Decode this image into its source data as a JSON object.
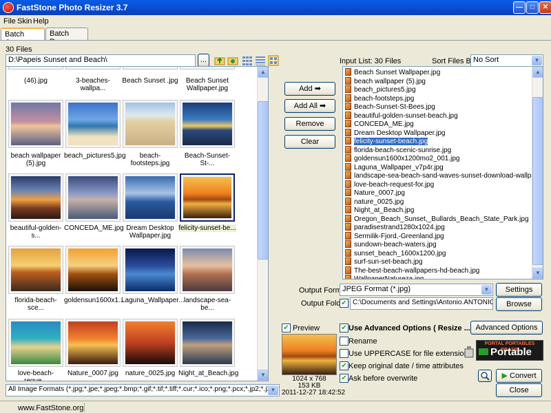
{
  "window": {
    "title": "FastStone Photo Resizer 3.7"
  },
  "menu": [
    "File",
    "Skin",
    "Help"
  ],
  "tabs": [
    "Batch Convert",
    "Batch Rename"
  ],
  "browser": {
    "file_count": "30 Files",
    "path": "D:\\Papeis Sunset and Beach\\",
    "browse_label": "...",
    "top_captions": [
      "(46).jpg",
      "3-beaches-wallpa...",
      "Beach Sunset .jpg",
      "Beach Sunset Wallpaper.jpg"
    ],
    "rows": [
      [
        "beach wallpaper (5).jpg",
        "beach_pictures5.jpg",
        "beach-footsteps.jpg",
        "Beach-Sunset-St-..."
      ],
      [
        "beautiful-golden-s...",
        "CONCEDA_ME.jpg",
        "Dream Desktop Wallpaper.jpg",
        "felicity-sunset-be..."
      ],
      [
        "florida-beach-sce...",
        "goldensun1600x1...",
        "Laguna_Wallpaper...",
        "landscape-sea-be..."
      ],
      [
        "love-beach-reque...",
        "Nature_0007.jpg",
        "nature_0025.jpg",
        "Night_at_Beach.jpg"
      ]
    ],
    "filter": "All Image Formats (*.jpg;*.jpe;*.jpeg;*.bmp;*.gif;*.tif;*.tiff;*.cur;*.ico;*.png;*.pcx;*.jp2;*.j2k;*.c"
  },
  "actions": {
    "add": "Add",
    "add_all": "Add All",
    "remove": "Remove",
    "clear": "Clear",
    "arrow": "➡"
  },
  "input_list": {
    "label": "Input List:",
    "count": "30 Files",
    "sort_label": "Sort Files By:",
    "sort_value": "No Sort",
    "items": [
      "Beach Sunset Wallpaper.jpg",
      "beach wallpaper (5).jpg",
      "beach_pictures5.jpg",
      "beach-footsteps.jpg",
      "Beach-Sunset-St-Bees.jpg",
      "beautiful-golden-sunset-beach.jpg",
      "CONCEDA_ME.jpg",
      "Dream Desktop Wallpaper.jpg",
      "felicity-sunset-beach.jpg",
      "florida-beach-scenic-sunrise.jpg",
      "goldensun1600x1200mo2_001.jpg",
      "Laguna_Wallpaper_v7p4r.jpg",
      "landscape-sea-beach-sand-waves-sunset-download-wallpapers.jpg",
      "love-beach-request-for.jpg",
      "Nature_0007.jpg",
      "nature_0025.jpg",
      "Night_at_Beach.jpg",
      "Oregon_Beach_Sunset,_Bullards_Beach_State_Park.jpg",
      "paradisestrand1280x1024.jpg",
      "Sermilik-Fjord,-Greenland.jpg",
      "sundown-beach-waters.jpg",
      "sunset_beach_1600x1200.jpg",
      "surf-sun-set-beach.jpg",
      "The-best-beach-wallpapers-hd-beach.jpg",
      "WallpaperNatureza.jpg"
    ],
    "selected_index": 8
  },
  "output": {
    "format_label": "Output Format:",
    "format_value": "JPEG Format (*.jpg)",
    "settings": "Settings",
    "folder_label": "Output Folder:",
    "folder_value": "C:\\Documents and Settings\\Antonio.ANTONIO-PC\\Des",
    "browse": "Browse"
  },
  "preview": {
    "label": "Preview",
    "dims": "1024 x 768",
    "size": "153 KB",
    "date": "2011-12-27 18:42:52"
  },
  "options": {
    "advanced": "Use Advanced Options ( Resize ... )",
    "advanced_btn": "Advanced Options",
    "rename": "Rename",
    "uppercase": "Use UPPERCASE for file extension",
    "keep_date": "Keep original date / time attributes",
    "ask_overwrite": "Ask before overwrite"
  },
  "badge": {
    "line1": "PORTAL PORTABLES BRASIL",
    "line2": "Portable"
  },
  "buttons": {
    "convert": "Convert",
    "close": "Close"
  },
  "status": {
    "site": "www.FastStone.org"
  }
}
